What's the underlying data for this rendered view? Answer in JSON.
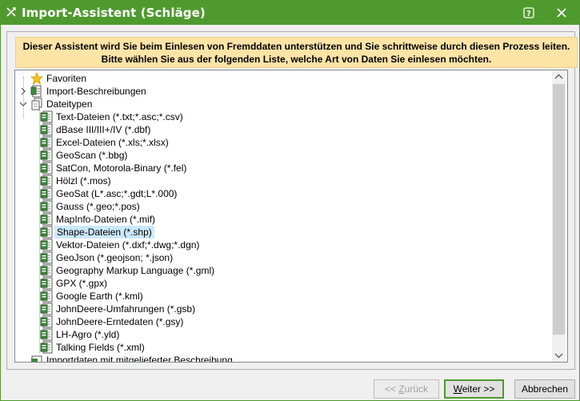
{
  "window": {
    "title": "Import-Assistent (Schläge)",
    "accent": "#4f9a2e"
  },
  "banner": {
    "line1": "Dieser Assistent wird Sie beim Einlesen von Fremddaten unterstützen und Sie schrittweise durch diesen Prozess leiten.",
    "line2": "Bitte wählen Sie aus der folgenden Liste, welche Art von Daten Sie einlesen möchten.",
    "color": "#fce4a6"
  },
  "tree": {
    "roots": [
      {
        "label": "Favoriten",
        "icon": "star-icon"
      },
      {
        "label": "Import-Beschreibungen",
        "icon": "document-stack-icon"
      },
      {
        "label": "Dateitypen",
        "icon": "pages-icon"
      }
    ],
    "file_types": [
      "Text-Dateien (*.txt;*.asc;*.csv)",
      "dBase III/III+/IV (*.dbf)",
      "Excel-Dateien (*.xls;*.xlsx)",
      "GeoScan (*.bbg)",
      "SatCon, Motorola-Binary (*.fel)",
      "Hölzl (*.mos)",
      "GeoSat (L*.asc;*.gdt;L*.000)",
      "Gauss (*.geo;*.pos)",
      "MapInfo-Dateien (*.mif)",
      "Shape-Dateien (*.shp)",
      "Vektor-Dateien (*.dxf;*.dwg;*.dgn)",
      "GeoJson (*.geojson; *.json)",
      "Geography Markup Language (*.gml)",
      "GPX (*.gpx)",
      "Google Earth (*.kml)",
      "JohnDeere-Umfahrungen (*.gsb)",
      "JohnDeere-Erntedaten (*.gsy)",
      "LH-Agro (*.yld)",
      "Talking Fields (*.xml)"
    ],
    "selected": "Shape-Dateien (*.shp)",
    "last_root": {
      "label": "Importdaten mit mitgelieferter Beschreibung",
      "icon": "folder-icon"
    }
  },
  "buttons": {
    "back": {
      "prefix": "<< ",
      "mnemonic": "Z",
      "rest": "urück"
    },
    "next": {
      "mnemonic": "W",
      "rest": "eiter >>"
    },
    "cancel": "Abbrechen"
  }
}
